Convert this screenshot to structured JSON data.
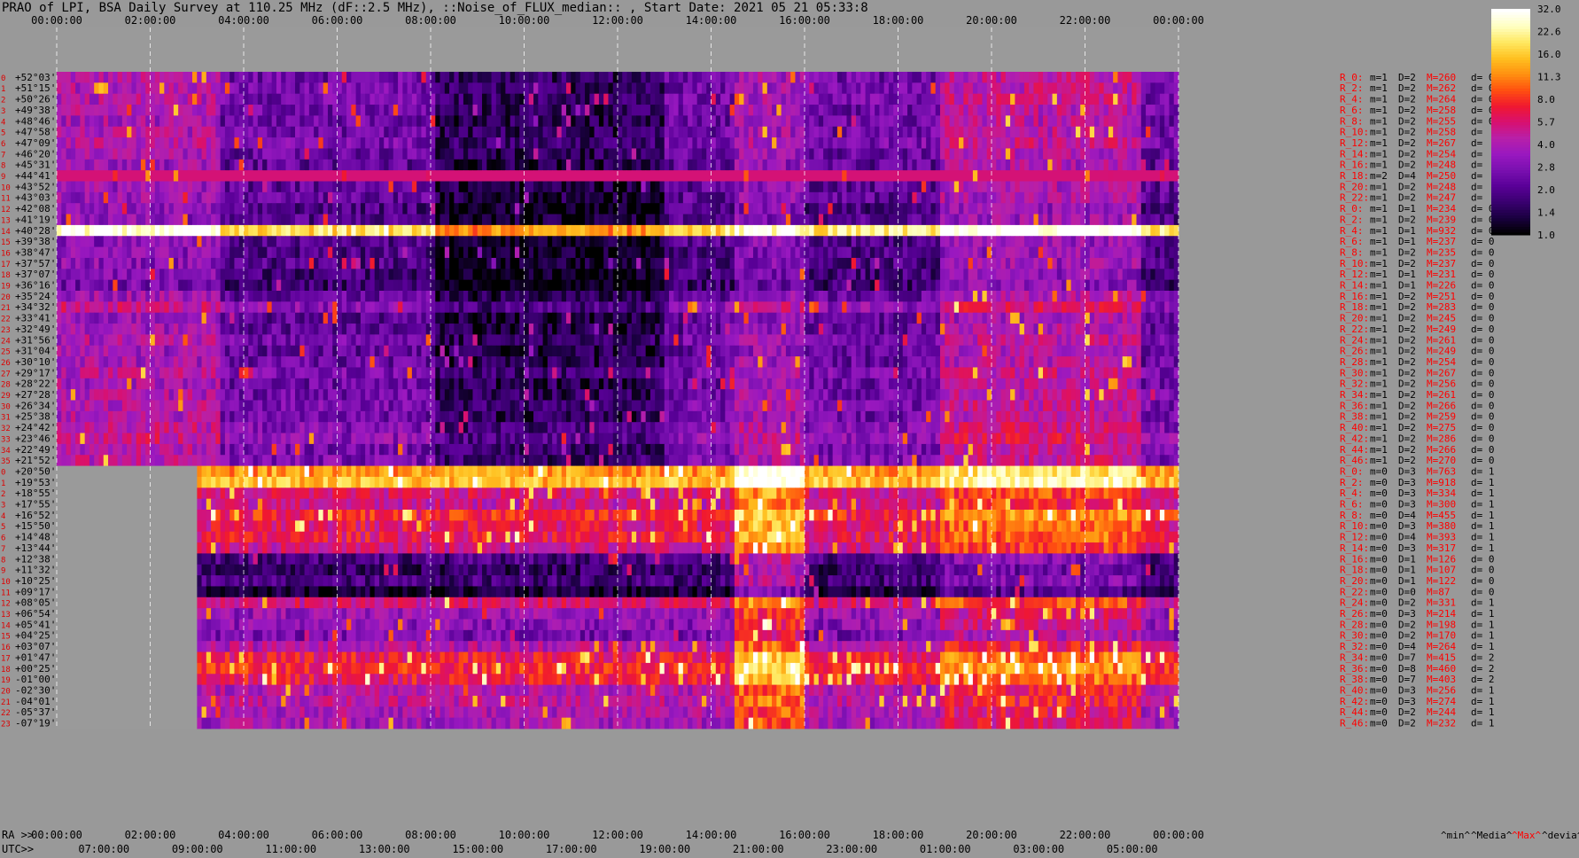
{
  "title": "PRAO of LPI, BSA Daily Survey at 110.25 MHz (dF::2.5 MHz), ::Noise_of_FLUX_median:: , Start Date: 2021 05 21 05:33:8",
  "colors": {
    "background": "#999999",
    "axis_text": "#000000",
    "row_index_text": "#dd0000",
    "stats_text": "#ff0000",
    "stats_text_alt": "#000000",
    "grid_line": "#ffffff"
  },
  "colormap": [
    "#000000",
    "#1a0040",
    "#3a0070",
    "#5a0098",
    "#7a10b0",
    "#9a18c0",
    "#b820a8",
    "#d81070",
    "#f01830",
    "#ff5010",
    "#ff9010",
    "#ffc020",
    "#ffe860",
    "#ffffc0",
    "#ffffff"
  ],
  "chart_data": {
    "type": "heatmap",
    "title": "PRAO of LPI, BSA Daily Survey at 110.25 MHz (dF::2.5 MHz), ::Noise_of_FLUX_median:: , Start Date: 2021 05 21 05:33:8",
    "top_axis_ticks": [
      "00:00:00",
      "02:00:00",
      "04:00:00",
      "06:00:00",
      "08:00:00",
      "10:00:00",
      "12:00:00",
      "14:00:00",
      "16:00:00",
      "18:00:00",
      "20:00:00",
      "22:00:00",
      "00:00:00"
    ],
    "ra_axis_prefix": "RA >>",
    "ra_axis_ticks": [
      "00:00:00",
      "02:00:00",
      "04:00:00",
      "06:00:00",
      "08:00:00",
      "10:00:00",
      "12:00:00",
      "14:00:00",
      "16:00:00",
      "18:00:00",
      "20:00:00",
      "22:00:00",
      "00:00:00"
    ],
    "utc_axis_prefix": "UTC>>",
    "utc_axis_ticks": [
      "07:00:00",
      "09:00:00",
      "11:00:00",
      "13:00:00",
      "15:00:00",
      "17:00:00",
      "19:00:00",
      "21:00:00",
      "23:00:00",
      "01:00:00",
      "03:00:00",
      "05:00:00"
    ],
    "colorbar_ticks": [
      "32.0",
      "22.6",
      "16.0",
      "11.3",
      "8.0",
      "5.7",
      "4.0",
      "2.8",
      "2.0",
      "1.4",
      "1.0"
    ],
    "colorbar_range": [
      1.0,
      32.0
    ],
    "colorbar_scale": "log",
    "footer_labels": {
      "min": "^min^",
      "median": "^Media^",
      "max": "^Max^",
      "dev": "^devia^"
    },
    "rows": [
      {
        "idx": "0",
        "dec": "+52°03'",
        "stat": "R_0:",
        "m": "m=1",
        "D": "D=2",
        "M": "M=260",
        "d": "d= 0"
      },
      {
        "idx": "1",
        "dec": "+51°15'",
        "stat": "R_2:",
        "m": "m=1",
        "D": "D=2",
        "M": "M=262",
        "d": "d= 0"
      },
      {
        "idx": "2",
        "dec": "+50°26'",
        "stat": "R_4:",
        "m": "m=1",
        "D": "D=2",
        "M": "M=264",
        "d": "d= 0"
      },
      {
        "idx": "3",
        "dec": "+49°38'",
        "stat": "R_6:",
        "m": "m=1",
        "D": "D=2",
        "M": "M=258",
        "d": "d= 0"
      },
      {
        "idx": "4",
        "dec": "+48°46'",
        "stat": "R_8:",
        "m": "m=1",
        "D": "D=2",
        "M": "M=255",
        "d": "d= 0"
      },
      {
        "idx": "5",
        "dec": "+47°58'",
        "stat": "R_10:",
        "m": "m=1",
        "D": "D=2",
        "M": "M=258",
        "d": "d="
      },
      {
        "idx": "6",
        "dec": "+47°09'",
        "stat": "R_12:",
        "m": "m=1",
        "D": "D=2",
        "M": "M=267",
        "d": "d="
      },
      {
        "idx": "7",
        "dec": "+46°20'",
        "stat": "R_14:",
        "m": "m=1",
        "D": "D=2",
        "M": "M=254",
        "d": "d="
      },
      {
        "idx": "8",
        "dec": "+45°31'",
        "stat": "R_16:",
        "m": "m=1",
        "D": "D=2",
        "M": "M=248",
        "d": "d="
      },
      {
        "idx": "9",
        "dec": "+44°41'",
        "stat": "R_18:",
        "m": "m=2",
        "D": "D=4",
        "M": "M=250",
        "d": "d="
      },
      {
        "idx": "10",
        "dec": "+43°52'",
        "stat": "R_20:",
        "m": "m=1",
        "D": "D=2",
        "M": "M=248",
        "d": "d="
      },
      {
        "idx": "11",
        "dec": "+43°03'",
        "stat": "R_22:",
        "m": "m=1",
        "D": "D=2",
        "M": "M=247",
        "d": "d="
      },
      {
        "idx": "12",
        "dec": "+42°08'",
        "stat": "R_0:",
        "m": "m=1",
        "D": "D=1",
        "M": "M=234",
        "d": "d= 0"
      },
      {
        "idx": "13",
        "dec": "+41°19'",
        "stat": "R_2:",
        "m": "m=1",
        "D": "D=2",
        "M": "M=239",
        "d": "d= 0"
      },
      {
        "idx": "14",
        "dec": "+40°28'",
        "stat": "R_4:",
        "m": "m=1",
        "D": "D=1",
        "M": "M=932",
        "d": "d= 0"
      },
      {
        "idx": "15",
        "dec": "+39°38'",
        "stat": "R_6:",
        "m": "m=1",
        "D": "D=1",
        "M": "M=237",
        "d": "d= 0"
      },
      {
        "idx": "16",
        "dec": "+38°47'",
        "stat": "R_8:",
        "m": "m=1",
        "D": "D=2",
        "M": "M=235",
        "d": "d= 0"
      },
      {
        "idx": "17",
        "dec": "+37°57'",
        "stat": "R_10:",
        "m": "m=1",
        "D": "D=2",
        "M": "M=237",
        "d": "d= 0"
      },
      {
        "idx": "18",
        "dec": "+37°07'",
        "stat": "R_12:",
        "m": "m=1",
        "D": "D=1",
        "M": "M=231",
        "d": "d= 0"
      },
      {
        "idx": "19",
        "dec": "+36°16'",
        "stat": "R_14:",
        "m": "m=1",
        "D": "D=1",
        "M": "M=226",
        "d": "d= 0"
      },
      {
        "idx": "20",
        "dec": "+35°24'",
        "stat": "R_16:",
        "m": "m=1",
        "D": "D=2",
        "M": "M=251",
        "d": "d= 0"
      },
      {
        "idx": "21",
        "dec": "+34°32'",
        "stat": "R_18:",
        "m": "m=1",
        "D": "D=2",
        "M": "M=283",
        "d": "d= 0"
      },
      {
        "idx": "22",
        "dec": "+33°41'",
        "stat": "R_20:",
        "m": "m=1",
        "D": "D=2",
        "M": "M=245",
        "d": "d= 0"
      },
      {
        "idx": "23",
        "dec": "+32°49'",
        "stat": "R_22:",
        "m": "m=1",
        "D": "D=2",
        "M": "M=249",
        "d": "d= 0"
      },
      {
        "idx": "24",
        "dec": "+31°56'",
        "stat": "R_24:",
        "m": "m=1",
        "D": "D=2",
        "M": "M=261",
        "d": "d= 0"
      },
      {
        "idx": "25",
        "dec": "+31°04'",
        "stat": "R_26:",
        "m": "m=1",
        "D": "D=2",
        "M": "M=249",
        "d": "d= 0"
      },
      {
        "idx": "26",
        "dec": "+30°10'",
        "stat": "R_28:",
        "m": "m=1",
        "D": "D=2",
        "M": "M=254",
        "d": "d= 0"
      },
      {
        "idx": "27",
        "dec": "+29°17'",
        "stat": "R_30:",
        "m": "m=1",
        "D": "D=2",
        "M": "M=267",
        "d": "d= 0"
      },
      {
        "idx": "28",
        "dec": "+28°22'",
        "stat": "R_32:",
        "m": "m=1",
        "D": "D=2",
        "M": "M=256",
        "d": "d= 0"
      },
      {
        "idx": "29",
        "dec": "+27°28'",
        "stat": "R_34:",
        "m": "m=1",
        "D": "D=2",
        "M": "M=261",
        "d": "d= 0"
      },
      {
        "idx": "30",
        "dec": "+26°34'",
        "stat": "R_36:",
        "m": "m=1",
        "D": "D=2",
        "M": "M=266",
        "d": "d= 0"
      },
      {
        "idx": "31",
        "dec": "+25°38'",
        "stat": "R_38:",
        "m": "m=1",
        "D": "D=2",
        "M": "M=259",
        "d": "d= 0"
      },
      {
        "idx": "32",
        "dec": "+24°42'",
        "stat": "R_40:",
        "m": "m=1",
        "D": "D=2",
        "M": "M=275",
        "d": "d= 0"
      },
      {
        "idx": "33",
        "dec": "+23°46'",
        "stat": "R_42:",
        "m": "m=1",
        "D": "D=2",
        "M": "M=286",
        "d": "d= 0"
      },
      {
        "idx": "34",
        "dec": "+22°49'",
        "stat": "R_44:",
        "m": "m=1",
        "D": "D=2",
        "M": "M=266",
        "d": "d= 0"
      },
      {
        "idx": "35",
        "dec": "+21°52'",
        "stat": "R_46:",
        "m": "m=1",
        "D": "D=2",
        "M": "M=270",
        "d": "d= 0"
      },
      {
        "idx": "0",
        "dec": "+20°50'",
        "stat": "R_0:",
        "m": "m=0",
        "D": "D=3",
        "M": "M=763",
        "d": "d= 1"
      },
      {
        "idx": "1",
        "dec": "+19°53'",
        "stat": "R_2:",
        "m": "m=0",
        "D": "D=3",
        "M": "M=918",
        "d": "d= 1"
      },
      {
        "idx": "2",
        "dec": "+18°55'",
        "stat": "R_4:",
        "m": "m=0",
        "D": "D=3",
        "M": "M=334",
        "d": "d= 1"
      },
      {
        "idx": "3",
        "dec": "+17°55'",
        "stat": "R_6:",
        "m": "m=0",
        "D": "D=3",
        "M": "M=300",
        "d": "d= 1"
      },
      {
        "idx": "4",
        "dec": "+16°52'",
        "stat": "R_8:",
        "m": "m=0",
        "D": "D=4",
        "M": "M=455",
        "d": "d= 1"
      },
      {
        "idx": "5",
        "dec": "+15°50'",
        "stat": "R_10:",
        "m": "m=0",
        "D": "D=3",
        "M": "M=380",
        "d": "d= 1"
      },
      {
        "idx": "6",
        "dec": "+14°48'",
        "stat": "R_12:",
        "m": "m=0",
        "D": "D=4",
        "M": "M=393",
        "d": "d= 1"
      },
      {
        "idx": "7",
        "dec": "+13°44'",
        "stat": "R_14:",
        "m": "m=0",
        "D": "D=3",
        "M": "M=317",
        "d": "d= 1"
      },
      {
        "idx": "8",
        "dec": "+12°38'",
        "stat": "R_16:",
        "m": "m=0",
        "D": "D=1",
        "M": "M=126",
        "d": "d= 0"
      },
      {
        "idx": "9",
        "dec": "+11°32'",
        "stat": "R_18:",
        "m": "m=0",
        "D": "D=1",
        "M": "M=107",
        "d": "d= 0"
      },
      {
        "idx": "10",
        "dec": "+10°25'",
        "stat": "R_20:",
        "m": "m=0",
        "D": "D=1",
        "M": "M=122",
        "d": "d= 0"
      },
      {
        "idx": "11",
        "dec": "+09°17'",
        "stat": "R_22:",
        "m": "m=0",
        "D": "D=0",
        "M": "M=87",
        "d": "d= 0"
      },
      {
        "idx": "12",
        "dec": "+08°05'",
        "stat": "R_24:",
        "m": "m=0",
        "D": "D=2",
        "M": "M=331",
        "d": "d= 1"
      },
      {
        "idx": "13",
        "dec": "+06°54'",
        "stat": "R_26:",
        "m": "m=0",
        "D": "D=3",
        "M": "M=214",
        "d": "d= 1"
      },
      {
        "idx": "14",
        "dec": "+05°41'",
        "stat": "R_28:",
        "m": "m=0",
        "D": "D=2",
        "M": "M=198",
        "d": "d= 1"
      },
      {
        "idx": "15",
        "dec": "+04°25'",
        "stat": "R_30:",
        "m": "m=0",
        "D": "D=2",
        "M": "M=170",
        "d": "d= 1"
      },
      {
        "idx": "16",
        "dec": "+03°07'",
        "stat": "R_32:",
        "m": "m=0",
        "D": "D=4",
        "M": "M=264",
        "d": "d= 1"
      },
      {
        "idx": "17",
        "dec": "+01°47'",
        "stat": "R_34:",
        "m": "m=0",
        "D": "D=7",
        "M": "M=415",
        "d": "d= 2"
      },
      {
        "idx": "18",
        "dec": "+00°25'",
        "stat": "R_36:",
        "m": "m=0",
        "D": "D=8",
        "M": "M=460",
        "d": "d= 2"
      },
      {
        "idx": "19",
        "dec": "-01°00'",
        "stat": "R_38:",
        "m": "m=0",
        "D": "D=7",
        "M": "M=403",
        "d": "d= 2"
      },
      {
        "idx": "20",
        "dec": "-02°30'",
        "stat": "R_40:",
        "m": "m=0",
        "D": "D=3",
        "M": "M=256",
        "d": "d= 1"
      },
      {
        "idx": "21",
        "dec": "-04°01'",
        "stat": "R_42:",
        "m": "m=0",
        "D": "D=3",
        "M": "M=274",
        "d": "d= 1"
      },
      {
        "idx": "22",
        "dec": "-05°37'",
        "stat": "R_44:",
        "m": "m=0",
        "D": "D=2",
        "M": "M=244",
        "d": "d= 1"
      },
      {
        "idx": "23",
        "dec": "-07°19'",
        "stat": "R_46:",
        "m": "m=0",
        "D": "D=2",
        "M": "M=232",
        "d": "d= 1"
      }
    ]
  }
}
